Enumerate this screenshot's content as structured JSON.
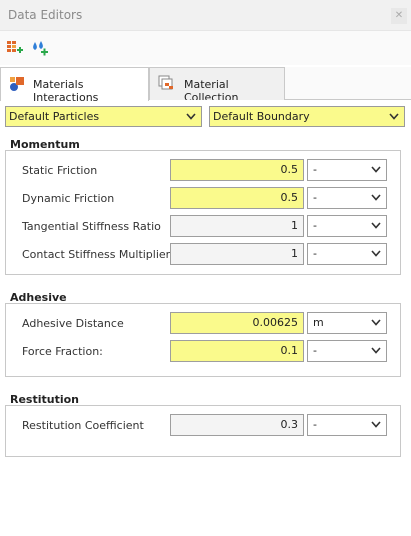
{
  "window": {
    "title": "Data Editors",
    "close_label": "✕"
  },
  "toolbar": {
    "icons": [
      "add-material-icon",
      "add-drops-icon"
    ]
  },
  "tabs": [
    {
      "label": "Materials Interactions",
      "icon": "materials-interactions-icon",
      "active": true
    },
    {
      "label": "Material Collection",
      "icon": "material-collection-icon",
      "active": false
    }
  ],
  "selectors": {
    "left": "Default Particles",
    "right": "Default Boundary"
  },
  "momentum": {
    "title": "Momentum",
    "rows": [
      {
        "label": "Static Friction",
        "value": "0.5",
        "unit": "-"
      },
      {
        "label": "Dynamic Friction",
        "value": "0.5",
        "unit": "-"
      },
      {
        "label": "Tangential Stiffness Ratio",
        "value": "1",
        "unit": "-"
      },
      {
        "label": "Contact Stiffness Multiplier",
        "value": "1",
        "unit": "-"
      }
    ]
  },
  "adhesive": {
    "title": "Adhesive",
    "rows": [
      {
        "label": "Adhesive Distance",
        "value": "0.00625",
        "unit": "m"
      },
      {
        "label": "Force Fraction:",
        "value": "0.1",
        "unit": "-"
      }
    ]
  },
  "restitution": {
    "title": "Restitution",
    "rows": [
      {
        "label": "Restitution Coefficient",
        "value": "0.3",
        "unit": "-"
      }
    ]
  },
  "colors": {
    "highlight": "#fafa8c",
    "border": "#9e9e9e",
    "accent_blue": "#2f7fd8",
    "accent_orange": "#e0682a",
    "accent_green": "#2aa84a"
  }
}
